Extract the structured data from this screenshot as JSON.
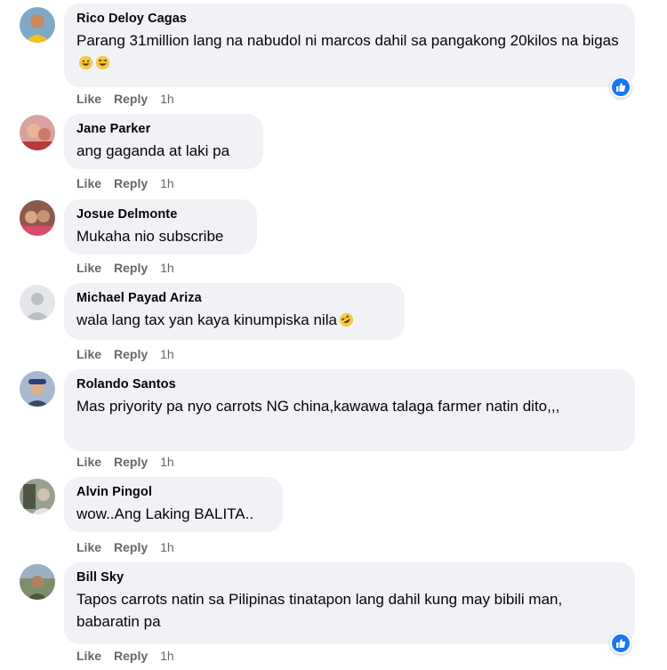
{
  "actions": {
    "like": "Like",
    "reply": "Reply"
  },
  "comments": [
    {
      "author": "Rico Deloy Cagas",
      "text": "Parang 31million lang na nabudol ni marcos dahil sa pangakong 20kilos na bigas",
      "emojis": [
        "sweat-smile-emoji",
        "laughing-emoji"
      ],
      "time": "1h",
      "reacted": true
    },
    {
      "author": "Jane Parker",
      "text": "ang gaganda at laki pa",
      "time": "1h"
    },
    {
      "author": "Josue Delmonte",
      "text": "Mukaha nio subscribe",
      "time": "1h"
    },
    {
      "author": "Michael Payad Ariza",
      "text": "wala lang tax yan kaya kinumpiska nila",
      "emojis": [
        "rofl-emoji"
      ],
      "time": "1h"
    },
    {
      "author": "Rolando Santos",
      "text": "Mas priyority pa nyo carrots NG china,kawawa talaga farmer natin dito,,,",
      "time": "1h"
    },
    {
      "author": "Alvin Pingol",
      "text": "wow..Ang Laking BALITA..",
      "time": "1h"
    },
    {
      "author": "Bill Sky",
      "text": "Tapos carrots natin sa Pilipinas tinatapon lang dahil kung may bibili man, babaratin pa",
      "time": "1h",
      "reacted": true
    }
  ],
  "colors": {
    "bubble": "#f0f2f5",
    "meta": "#65676b",
    "like_blue": "#1877f2"
  }
}
